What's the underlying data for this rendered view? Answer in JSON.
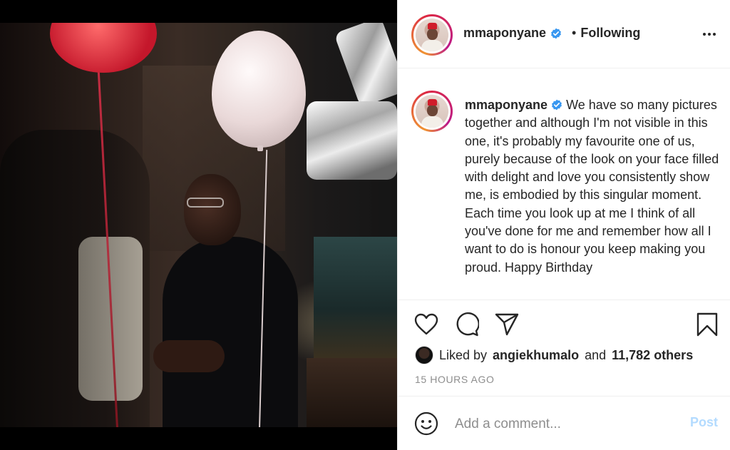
{
  "post": {
    "username": "mmaponyane",
    "verified": true,
    "follow_separator": "•",
    "follow_status": "Following",
    "caption": "We have so many pictures together and although I'm not visible in this one, it's probably my favourite one of us, purely because of the look on your face filled with delight and love you consistently show me, is embodied by this singular moment. Each time you look up at me I think of all you've done for me and remember how all I want to do is honour you keep making you proud. Happy Birthday",
    "likes": {
      "prefix": "Liked by",
      "liker": "angiekhumalo",
      "connector": "and",
      "others": "11,782 others"
    },
    "timestamp": "15 HOURS AGO"
  },
  "comment": {
    "placeholder": "Add a comment...",
    "post_label": "Post"
  },
  "icons": {
    "like": "heart-icon",
    "comment": "comment-bubble-icon",
    "share": "paper-plane-icon",
    "save": "bookmark-icon",
    "emoji": "smiley-icon",
    "verified": "verified-badge-icon",
    "more": "more-options-icon"
  },
  "colors": {
    "verified_blue": "#3897f0",
    "post_button_disabled": "#b3dbff",
    "text": "#262626",
    "muted": "#8e8e8e"
  }
}
